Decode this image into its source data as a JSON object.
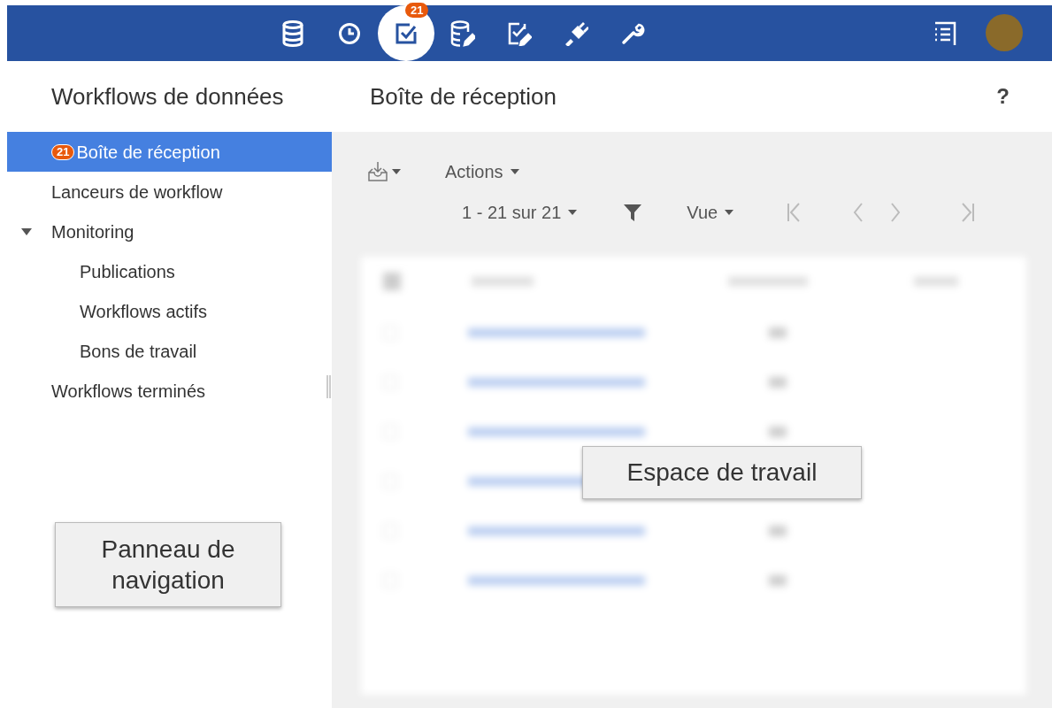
{
  "top_bar": {
    "nav_icons": [
      {
        "selected": false
      },
      {
        "selected": false
      },
      {
        "selected": true,
        "badge": "21"
      },
      {
        "selected": false
      },
      {
        "selected": false
      },
      {
        "selected": false
      },
      {
        "selected": false
      }
    ]
  },
  "sidebar": {
    "title": "Workflows de données",
    "items": [
      {
        "label": "Boîte de réception",
        "badge": "21",
        "selected": true
      },
      {
        "label": "Lanceurs de workflow",
        "selected": false
      },
      {
        "label": "Monitoring",
        "selected": false,
        "expanded": true,
        "children": [
          {
            "label": "Publications",
            "selected": false
          },
          {
            "label": "Workflows actifs",
            "selected": false
          },
          {
            "label": "Bons de travail",
            "selected": false
          }
        ]
      },
      {
        "label": "Workflows terminés",
        "selected": false
      }
    ]
  },
  "workspace": {
    "title": "Boîte de réception",
    "help": "?",
    "actions_menu": "Actions",
    "range": "1 - 21 sur 21",
    "view_menu": "Vue"
  },
  "callouts": [
    {
      "text": "Espace de travail"
    },
    {
      "text": "Panneau de navigation"
    }
  ]
}
